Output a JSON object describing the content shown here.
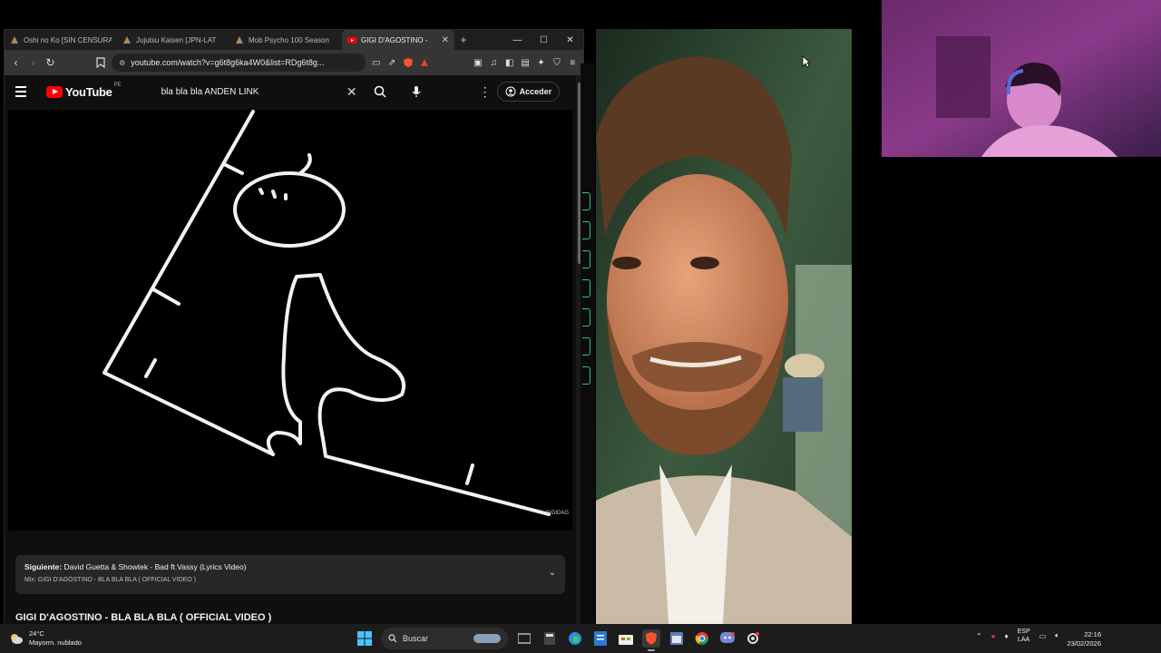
{
  "browser": {
    "tabs": [
      {
        "label": "Oshi no Ko [SIN CENSURA",
        "active": false
      },
      {
        "label": "Jujutsu Kaisen [JPN-LAT",
        "active": false
      },
      {
        "label": "Mob Psycho 100 Season",
        "active": false
      },
      {
        "label": "GIGI D'AGOSTINO -",
        "active": true
      }
    ],
    "new_tab": "+",
    "url": "youtube.com/watch?v=g6t8g6ka4W0&list=RDg6t8g..."
  },
  "youtube": {
    "logo_text": "YouTube",
    "country": "PE",
    "search_query": "bla bla bla ANDEN LINK",
    "signin_label": "Acceder",
    "watermark": "GIGIDAG",
    "up_next": {
      "prefix": "Siguiente:",
      "title": "David Guetta & Showtek - Bad ft.Vassy (Lyrics Video)",
      "mix": "Mix: GIGI D'AGOSTINO - BLA BLA BLA ( OFFICIAL VIDEO )"
    },
    "video_title": "GIGI D'AGOSTINO - BLA BLA BLA ( OFFICIAL VIDEO )"
  },
  "taskbar": {
    "weather_temp": "24°C",
    "weather_desc": "Mayorm. nublado",
    "search_label": "Buscar",
    "lang_top": "ESP",
    "lang_bottom": "LAA",
    "time": "22:16",
    "date": "23/02/2026"
  },
  "colors": {
    "yt_red": "#ff0000",
    "background": "#0f0f0f",
    "accent_green": "#22cc77"
  }
}
